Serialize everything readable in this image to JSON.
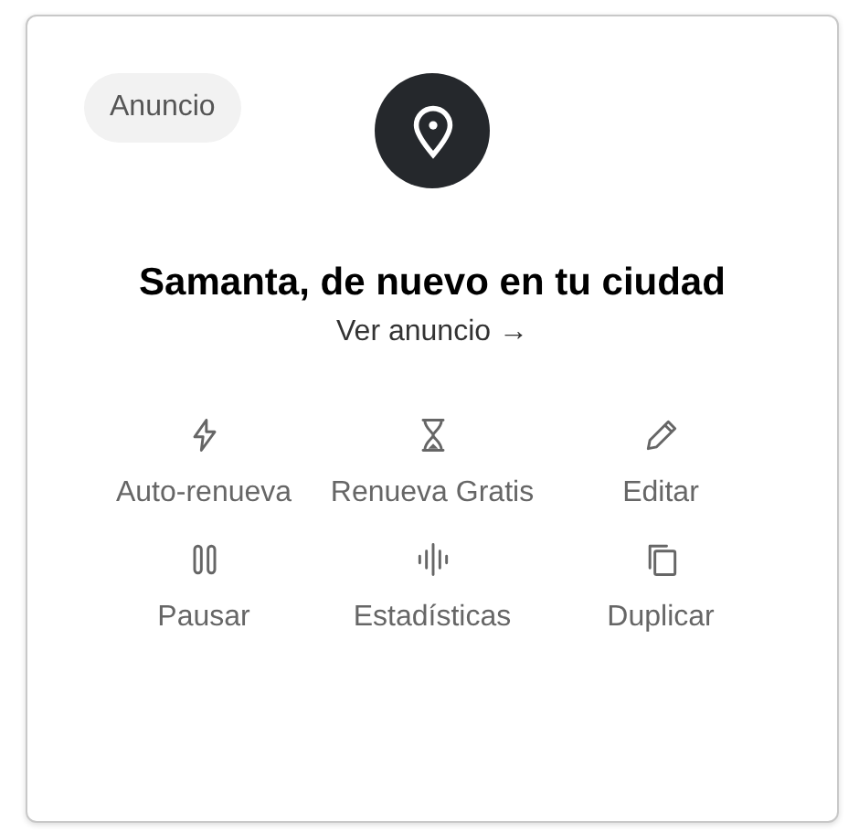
{
  "badge": "Anuncio",
  "title": "Samanta, de nuevo en tu ciudad",
  "link": "Ver anuncio →",
  "actions": [
    {
      "kind": "bolt",
      "label": "Auto-renueva"
    },
    {
      "kind": "hourglass",
      "label": "Renueva Gratis"
    },
    {
      "kind": "pencil",
      "label": "Editar"
    },
    {
      "kind": "pause",
      "label": "Pausar"
    },
    {
      "kind": "wave",
      "label": "Estadísticas"
    },
    {
      "kind": "copy",
      "label": "Duplicar"
    }
  ]
}
